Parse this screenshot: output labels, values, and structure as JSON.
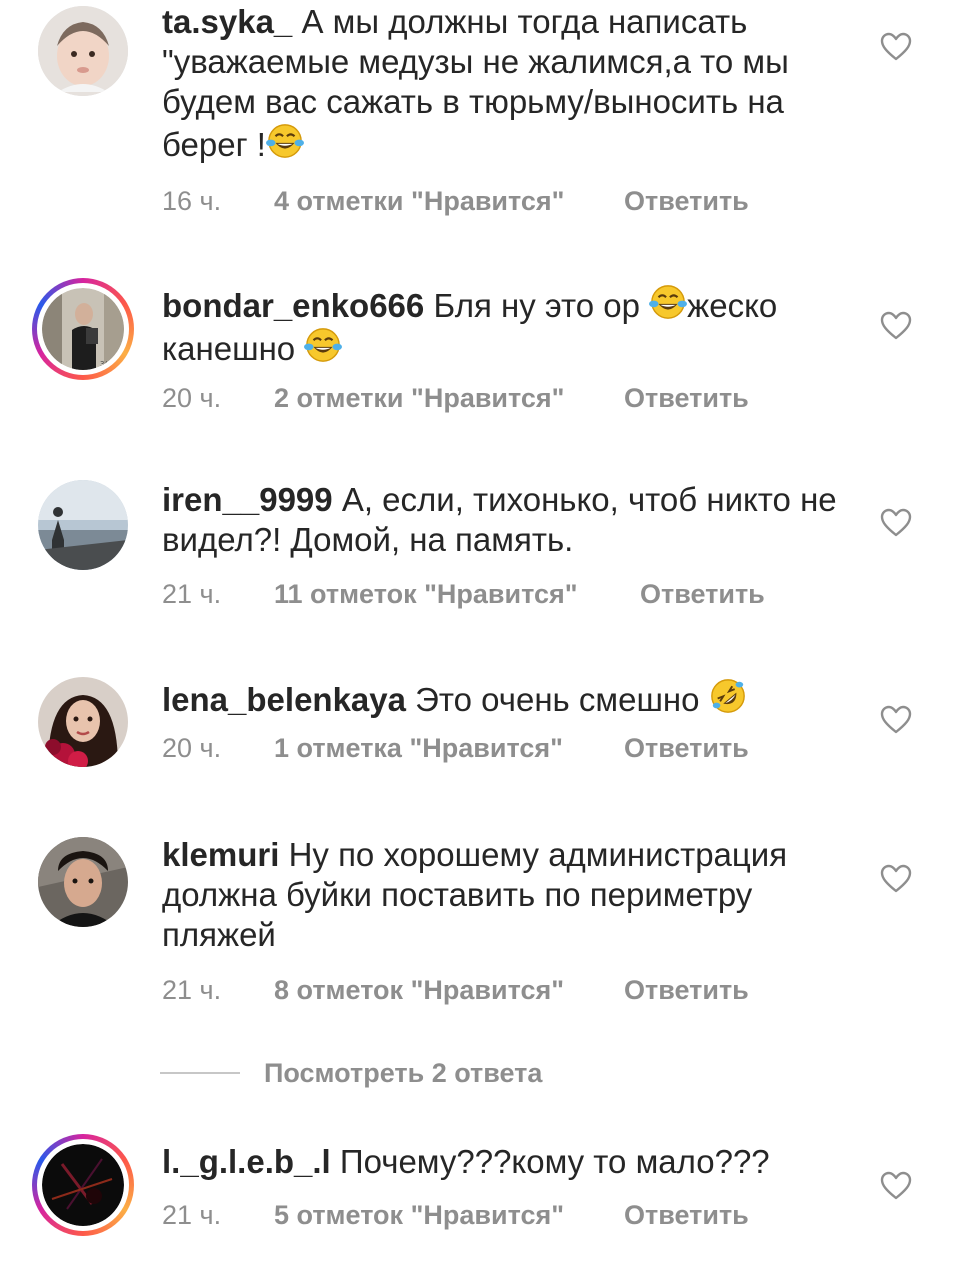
{
  "comments": [
    {
      "username": "ta.syka_",
      "text": "А мы должны тогда написать \"уважаемые медузы не жалимся,а то мы будем вас сажать в тюрьму/выносить на берег !",
      "time": "16 ч.",
      "likes": "4 отметки \"Нравится\"",
      "reply": "Ответить"
    },
    {
      "username": "bondar_enko666",
      "text_part1": "Бля ну это ор",
      "text_part2": "жеско канешно",
      "time": "20 ч.",
      "likes": "2 отметки \"Нравится\"",
      "reply": "Ответить"
    },
    {
      "username": "iren__9999",
      "text": "А, если, тихонько, чтоб никто не видел?! Домой, на память.",
      "time": "21 ч.",
      "likes": "11 отметок \"Нравится\"",
      "reply": "Ответить"
    },
    {
      "username": "lena_belenkaya",
      "text": "Это очень смешно",
      "time": "20 ч.",
      "likes": "1 отметка \"Нравится\"",
      "reply": "Ответить"
    },
    {
      "username": "klemuri",
      "text": "Ну по хорошему администрация должна  буйки поставить по периметру пляжей",
      "time": "21 ч.",
      "likes": "8 отметок \"Нравится\"",
      "reply": "Ответить"
    },
    {
      "username": "l._g.l.e.b_.l",
      "text": "Почему???кому то мало???",
      "time": "21 ч.",
      "likes": "5 отметок \"Нравится\"",
      "reply": "Ответить"
    }
  ],
  "view_replies": "Посмотреть 2 ответа",
  "icons": {
    "like": "heart-outline-icon",
    "laugh": "tears-of-joy-emoji",
    "rofl": "rolling-laughing-emoji"
  },
  "colors": {
    "text": "#262626",
    "meta": "#8e8e8e",
    "divider": "#c7c7c7"
  }
}
